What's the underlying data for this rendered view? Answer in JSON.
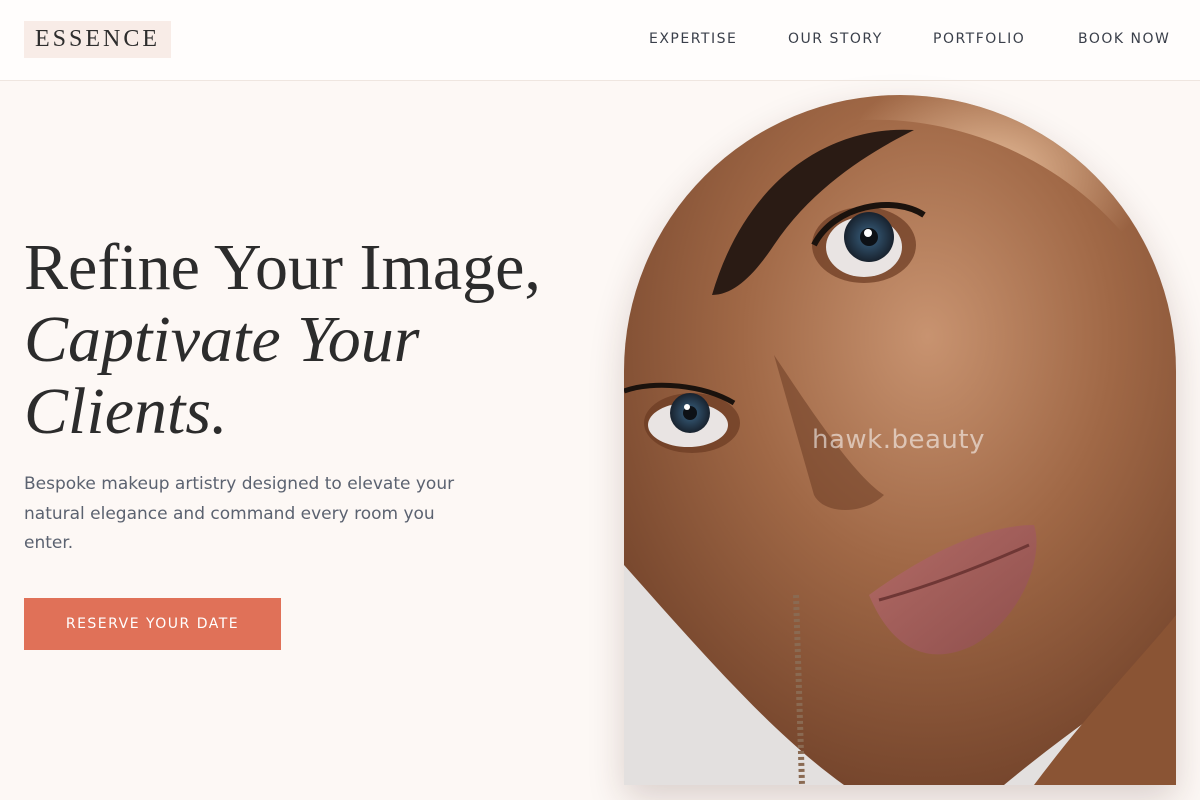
{
  "brand": {
    "logo": "ESSENCE"
  },
  "nav": {
    "items": [
      {
        "label": "EXPERTISE"
      },
      {
        "label": "OUR STORY"
      },
      {
        "label": "PORTFOLIO"
      },
      {
        "label": "BOOK NOW"
      }
    ]
  },
  "hero": {
    "title_line1": "Refine Your Image,",
    "title_line2": "Captivate Your",
    "title_line3": "Clients.",
    "subtitle": "Bespoke makeup artistry designed to elevate your natural elegance and command every room you enter.",
    "cta_label": "RESERVE YOUR DATE",
    "image_watermark": "hawk.beauty"
  },
  "colors": {
    "background": "#fdf8f5",
    "accent": "#e07158",
    "logo_bg": "#f8ece7",
    "text_dark": "#2c2c2c",
    "text_muted": "#5b6270"
  }
}
